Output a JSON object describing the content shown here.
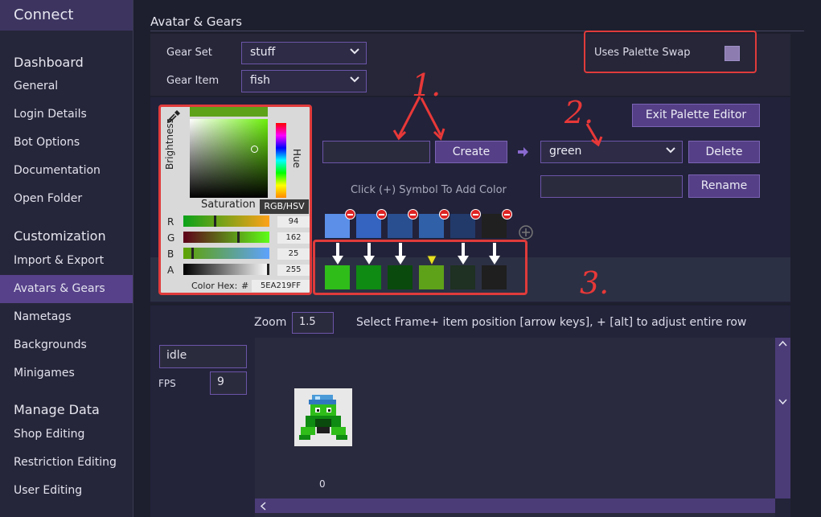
{
  "app_title": "Connect",
  "sidebar": {
    "sections": [
      {
        "title": "Dashboard",
        "items": [
          "General",
          "Login Details",
          "Bot Options",
          "Documentation",
          "Open Folder"
        ]
      },
      {
        "title": "Customization",
        "items": [
          "Import & Export",
          "Avatars & Gears",
          "Nametags",
          "Backgrounds",
          "Minigames"
        ]
      },
      {
        "title": "Manage Data",
        "items": [
          "Shop Editing",
          "Restriction Editing",
          "User Editing"
        ]
      }
    ],
    "active_item": "Avatars & Gears"
  },
  "header": {
    "title": "Avatar & Gears"
  },
  "gear": {
    "set_label": "Gear Set",
    "set_value": "stuff",
    "item_label": "Gear Item",
    "item_value": "fish",
    "palette_swap_label": "Uses Palette Swap"
  },
  "color_picker": {
    "brightness_label": "Brightness",
    "hue_label": "Hue",
    "saturation_label": "Saturation",
    "mode_label": "RGB/HSV",
    "channels": [
      {
        "name": "R",
        "value": "94",
        "fraction": 0.37
      },
      {
        "name": "G",
        "value": "162",
        "fraction": 0.64
      },
      {
        "name": "B",
        "value": "25",
        "fraction": 0.1
      },
      {
        "name": "A",
        "value": "255",
        "fraction": 1.0
      }
    ],
    "hex_label": "Color Hex:",
    "hex_prefix": "#",
    "hex_value": "5EA219FF"
  },
  "palette": {
    "create_input_value": "",
    "create_label": "Create",
    "selected_palette": "green",
    "delete_label": "Delete",
    "rename_input_value": "",
    "rename_label": "Rename",
    "exit_label": "Exit Palette Editor",
    "hint": "Click (+) Symbol To Add Color",
    "source_colors": [
      "#5b8fe8",
      "#3463c0",
      "#2a4f90",
      "#3060a8",
      "#223a6a",
      "#202020"
    ],
    "target_colors": [
      "#2fbd1a",
      "#0f8a12",
      "#0a4a0c",
      "#5ea219",
      "#1f3122",
      "#1f1f1f"
    ],
    "selected_index": 3
  },
  "preview": {
    "zoom_label": "Zoom",
    "zoom_value": "1.5",
    "instruction": "Select Frame+ item position [arrow keys], + [alt] to adjust entire row",
    "animation_value": "idle",
    "fps_label": "FPS",
    "fps_value": "9",
    "frame_index": "0"
  },
  "annotations": {
    "one": "1.",
    "two": "2.",
    "three": "3."
  },
  "colors": {
    "accent": "#553f86",
    "highlight": "#e03b3b",
    "sidebar_active": "#57418a"
  }
}
